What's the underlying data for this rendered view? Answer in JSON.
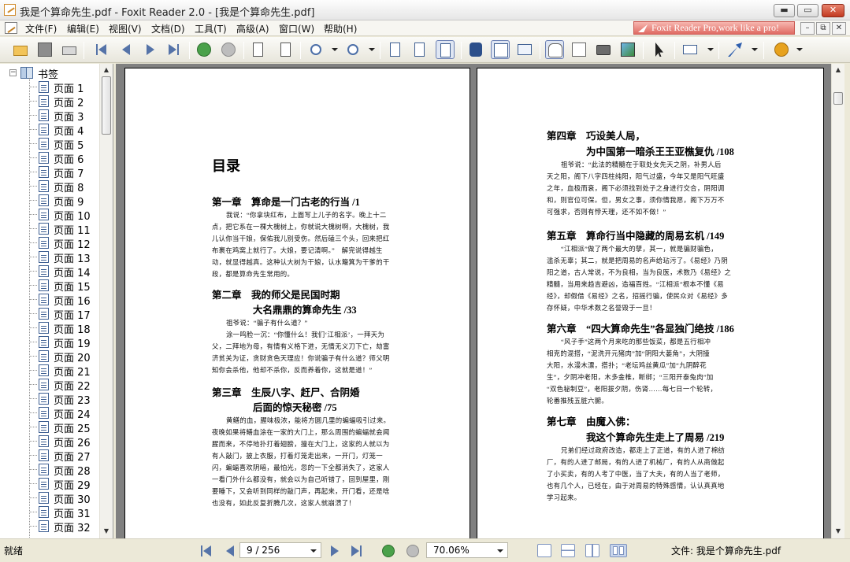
{
  "window": {
    "title": "我是个算命先生.pdf - Foxit Reader 2.0 - [我是个算命先生.pdf]",
    "minimize": "▬",
    "maximize": "▭",
    "close": "✕"
  },
  "menubar": {
    "items": [
      "文件(F)",
      "编辑(E)",
      "视图(V)",
      "文档(D)",
      "工具(T)",
      "高级(A)",
      "窗口(W)",
      "帮助(H)"
    ],
    "promo": "Foxit Reader Pro,work like a pro!",
    "mdi": [
      "–",
      "⧉",
      "✕"
    ]
  },
  "toolbar": {
    "icons": [
      "open-icon",
      "save-icon",
      "print-icon",
      "first-page-icon",
      "prev-page-icon",
      "next-page-icon",
      "last-page-icon",
      "back-icon",
      "forward-icon",
      "rotate-ccw-icon",
      "rotate-cw-icon",
      "zoom-out-icon",
      "zoom-in-icon",
      "actual-size-icon",
      "fit-page-icon",
      "fit-width-icon",
      "find-icon",
      "bookmarks-panel-icon",
      "thumbnail-icon",
      "hand-tool-icon",
      "text-select-icon",
      "snapshot-icon",
      "image-icon",
      "select-arrow-icon",
      "typewriter-icon",
      "arrow-tool-icon",
      "help-icon"
    ]
  },
  "sidebar": {
    "root_label": "书签",
    "items": [
      "页面 1",
      "页面 2",
      "页面 3",
      "页面 4",
      "页面 5",
      "页面 6",
      "页面 7",
      "页面 8",
      "页面 9",
      "页面 10",
      "页面 11",
      "页面 12",
      "页面 13",
      "页面 14",
      "页面 15",
      "页面 16",
      "页面 17",
      "页面 18",
      "页面 19",
      "页面 20",
      "页面 21",
      "页面 22",
      "页面 23",
      "页面 24",
      "页面 25",
      "页面 26",
      "页面 27",
      "页面 28",
      "页面 29",
      "页面 30",
      "页面 31",
      "页面 32"
    ]
  },
  "document": {
    "left_page": {
      "heading": "目录",
      "chapters": [
        {
          "title": "第一章　算命是一门古老的行当 /1",
          "excerpt": [
            "我说：“你拿块红布，上面写上儿子的名字。晚上十二",
            "点，把它系在一棵大槐树上，你就说大槐树啊，大槐树，我",
            "儿认你当干娘，保佑我儿别受伤。然后磕三个头，回来把红",
            "布裹在鸡窝上就行了。大娘，要记清啊。”　解完说得越生",
            "动，就显得越真。这种认大树为干娘，认水簸箕为干爹的干",
            "段，都是算命先生常用的。"
          ]
        },
        {
          "title": "第二章　我的师父是民国时期",
          "subtitle": "大名鼎鼎的算命先生 /33",
          "excerpt": [
            "祖爷说：“骗子有什么道？”",
            "涂一鸣脸一沉：“你懂什么！我们‘江相派’，一拜天为",
            "父，二拜地为母，有情有义格下进，无情无义刀下亡，劫富",
            "济贫关为证，贪财贪色天理应！你说骗子有什么道？师父明",
            "知你会杀他，他却不杀你，反而养着你，这就是道！”"
          ]
        },
        {
          "title": "第三章　生辰八字、赶尸、合阴婚",
          "subtitle": "后面的惊天秘密 /75",
          "excerpt": [
            "黄鳝的血，腥味极浓，能将方圆几里的蝙蝠吸引过来。",
            "夜晚如果将鳝血涂在一家的大门上，那么周围的蝙蝠就会闻",
            "腥而来，不停地扑打着翅膀，撞在大门上，这家的人就以为",
            "有人敲门，披上衣服，打着灯笼走出来，一开门，灯笼一",
            "闪，蝙蝠喜欢阴暗，最怕光，忽的一下全都消失了，这家人",
            "一看门外什么都没有，就会以为自己听错了，回到屋里，刚",
            "要睡下，又会听到同样的敲门声，再起来，开门看，还是啥",
            "也没有，如此反复折腾几次，这家人就崩溃了！"
          ]
        }
      ]
    },
    "right_page": {
      "chapters": [
        {
          "title": "第四章　巧设美人局，",
          "subtitle": "为中国第一暗杀王王亚樵复仇 /108",
          "excerpt": [
            "祖爷说：“此法的精髓在于取处女先天之阴，补男人后",
            "天之阳，阁下八字四柱纯阳，阳气过盛，今年又是阳气旺盛",
            "之年，血极而衰，阁下必须找到处子之身进行交合，阴阳调",
            "和，则官位可保。但，男女之事，须你情我愿，阁下万万不",
            "可强求，否则有悖天理，还不如不做！”"
          ]
        },
        {
          "title": "第五章　算命行当中隐藏的周易玄机 /149",
          "excerpt": [
            "“江相派”做了两个最大的孽，其一，就是骗财骗色，",
            "滥杀无辜；其二，就是把周易的名声给玷污了。《易经》乃阴",
            "阳之道，古人常说，不为良相，当为良医，术数乃《易经》之",
            "精髓，当用来趋吉避凶，造福百姓。“江相派”根本不懂《易",
            "经》，却假借《易经》之名，招摇行骗，使民众对《易经》多",
            "存怀疑，中华术数之名誉毁于一旦！"
          ]
        },
        {
          "title": "第六章　“四大算命先生”各显独门绝技 /186",
          "excerpt": [
            "“风子手”这两个月来吃的那些饭菜，都是五行相冲",
            "相克的混搭，“泥洗开元猪肉”加“阴阳大蒌角”，大阴撞",
            "大阳，水漫木漂，搭扑；“老坛鸡丝黄瓜”加“九阴醉花",
            "生”，夕阴冲老阳，木多金椎，断绑；“三阳开泰兔肉”加",
            "“双色秘制豆”，老阳拔夕阴，伤肾……每七日一个轮转，",
            "轮番推残五脏六腑。"
          ]
        },
        {
          "title": "第七章　由魔入佛：",
          "subtitle": "我这个算命先生走上了周易 /219",
          "excerpt": [
            "兄弟们经过政府改造，都走上了正道，有的人进了棉纺",
            "厂，有的人进了邮局，有的人进了机械厂，有的人从商做起",
            "了小买卖，有的人考了中医，当了大夫，有的人当了老师，",
            "也有几个人，已经在，由于对周易的特殊感情，认认真真地",
            "学习起来。"
          ]
        }
      ]
    }
  },
  "statusbar": {
    "status": "就绪",
    "page_indicator": "9 / 256",
    "zoom": "70.06%",
    "file_label": "文件: 我是个算命先生.pdf"
  },
  "colors": {
    "chrome": "#ece9d8",
    "doc_background": "#808080",
    "page": "#ffffff",
    "close_button": "#c23a22",
    "promo": "#e06b63",
    "icon_blue": "#3e5f92"
  }
}
